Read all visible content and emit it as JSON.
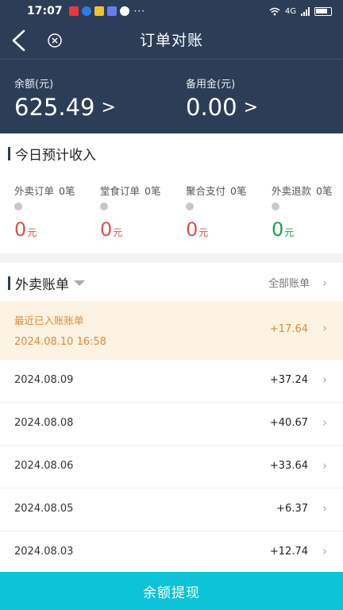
{
  "status_bar": {
    "time": "17:07",
    "network": "4G"
  },
  "nav": {
    "title": "订单对账"
  },
  "balance": {
    "label": "余额(元)",
    "value": "625.49",
    "reserve_label": "备用金(元)",
    "reserve_value": "0.00",
    "arrow": ">"
  },
  "income": {
    "title": "今日预计收入",
    "items": [
      {
        "label": "外卖订单",
        "count": "0笔",
        "amount": "0",
        "unit": "元",
        "color": "#d9534f"
      },
      {
        "label": "堂食订单",
        "count": "0笔",
        "amount": "0",
        "unit": "元",
        "color": "#d9534f"
      },
      {
        "label": "聚合支付",
        "count": "0笔",
        "amount": "0",
        "unit": "元",
        "color": "#d9534f"
      },
      {
        "label": "外卖退款",
        "count": "0笔",
        "amount": "0",
        "unit": "元",
        "color": "#19a34a"
      }
    ]
  },
  "bills": {
    "title": "外卖账单",
    "all_label": "全部账单",
    "recent": {
      "label": "最近已入账账单",
      "datetime": "2024.08.10 16:58",
      "amount": "+17.64"
    },
    "rows": [
      {
        "date": "2024.08.09",
        "amount": "+37.24"
      },
      {
        "date": "2024.08.08",
        "amount": "+40.67"
      },
      {
        "date": "2024.08.06",
        "amount": "+33.64"
      },
      {
        "date": "2024.08.05",
        "amount": "+6.37"
      },
      {
        "date": "2024.08.03",
        "amount": "+12.74"
      }
    ]
  },
  "footer": {
    "withdraw_label": "余额提现"
  },
  "colors": {
    "header_bg": "#2c3e57",
    "accent_button": "#0cc3d8",
    "recent_bg": "#fdf3e3",
    "recent_text": "#e08a3c"
  }
}
